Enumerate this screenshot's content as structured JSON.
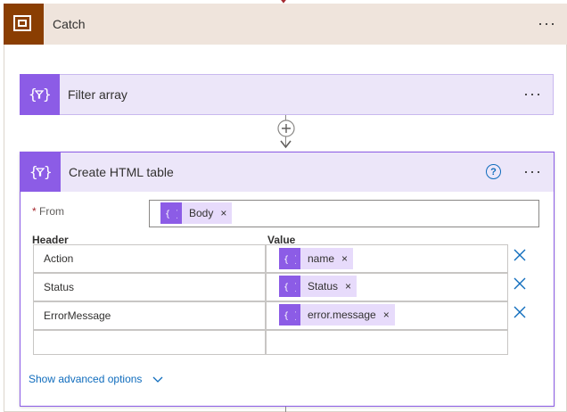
{
  "catch": {
    "title": "Catch",
    "more": "···"
  },
  "filter_array": {
    "title": "Filter array",
    "more": "···"
  },
  "html_table": {
    "title": "Create HTML table",
    "help": "?",
    "more": "···",
    "from": {
      "required_mark": "*",
      "label": "From",
      "token": {
        "label": "Body",
        "remove": "×"
      }
    },
    "columns": {
      "header_label": "Header",
      "value_label": "Value"
    },
    "rows": [
      {
        "header": "Action",
        "value_token": "name"
      },
      {
        "header": "Status",
        "value_token": "Status"
      },
      {
        "header": "ErrorMessage",
        "value_token": "error.message"
      }
    ],
    "token_remove": "×",
    "show_advanced": "Show advanced options"
  },
  "colors": {
    "catch_icon_bg": "#8a3e02",
    "catch_header_bg": "#efe4dc",
    "action_accent": "#8c5ce6",
    "action_header_bg": "#ece6f9",
    "token_bg": "#e7dbfb",
    "link": "#0f6cbd",
    "delete_x": "#0f6cbd"
  },
  "icons": {
    "catch": "scope-icon",
    "action": "data-operation-icon",
    "add": "plus-circle-icon",
    "delete": "close-icon",
    "expand": "chevron-down-icon"
  }
}
